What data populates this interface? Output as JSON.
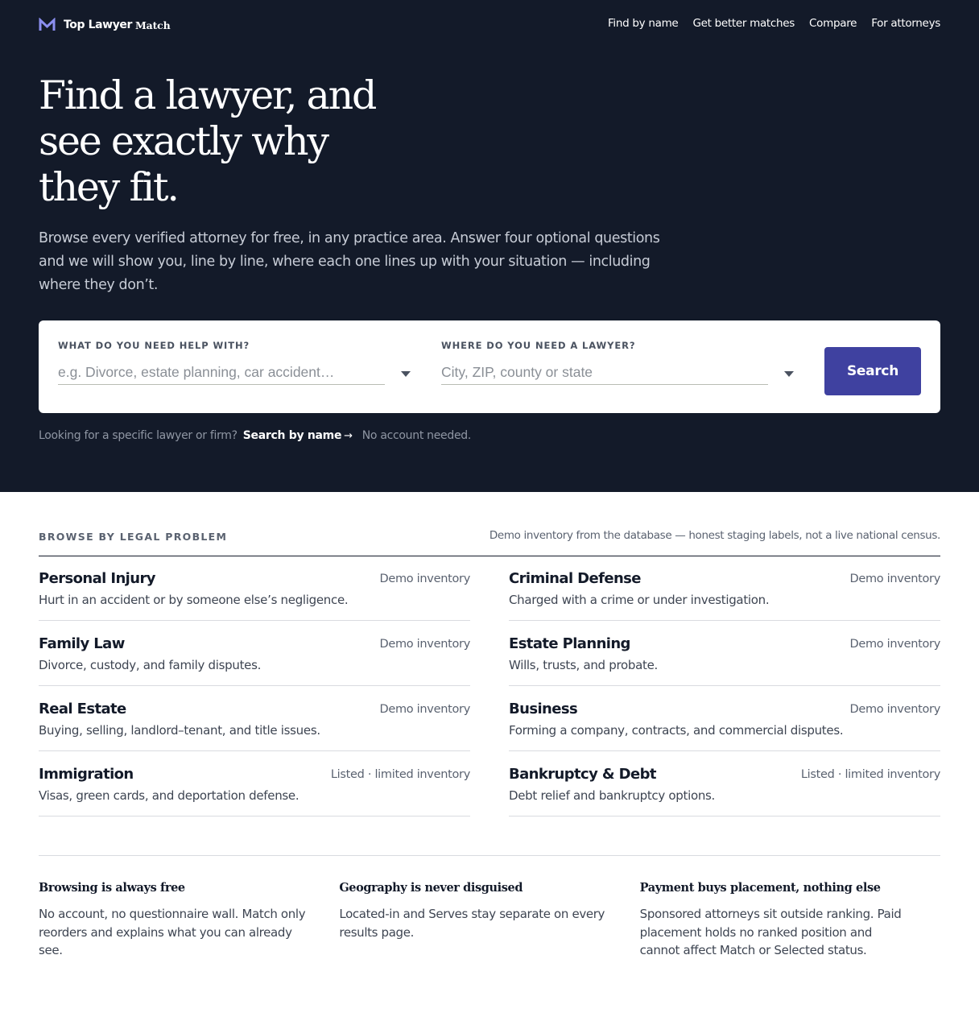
{
  "brand": {
    "main": "Top Lawyer",
    "sub": "Match",
    "icon": "m-logo-icon",
    "accent": "#8b8ff0"
  },
  "nav": {
    "items": [
      "Find by name",
      "Get better matches",
      "Compare",
      "For attorneys"
    ]
  },
  "hero": {
    "headline": "Find a lawyer, and see exactly why they fit.",
    "subtext": "Browse every verified attorney for free, in any practice area. Answer four optional questions and we will show you, line by line, where each one lines up with your situation — including where they don’t."
  },
  "search": {
    "problem_label": "WHAT DO YOU NEED HELP WITH?",
    "problem_placeholder": "e.g. Divorce, estate planning, car accident…",
    "location_label": "WHERE DO YOU NEED A LAWYER?",
    "location_placeholder": "City, ZIP, county or state",
    "button_label": "Search",
    "button_color": "#3f41a0"
  },
  "hint": {
    "text": "Looking for a specific lawyer or firm?",
    "link": "Search by name",
    "arrow": "→",
    "note": "No account needed."
  },
  "browse": {
    "title": "BROWSE BY LEGAL PROBLEM",
    "note": "Demo inventory from the database — honest staging labels, not a live national census.",
    "categories": [
      {
        "title": "Personal Injury",
        "status": "Demo inventory",
        "desc": "Hurt in an accident or by someone else’s negligence."
      },
      {
        "title": "Criminal Defense",
        "status": "Demo inventory",
        "desc": "Charged with a crime or under investigation."
      },
      {
        "title": "Family Law",
        "status": "Demo inventory",
        "desc": "Divorce, custody, and family disputes."
      },
      {
        "title": "Estate Planning",
        "status": "Demo inventory",
        "desc": "Wills, trusts, and probate."
      },
      {
        "title": "Real Estate",
        "status": "Demo inventory",
        "desc": "Buying, selling, landlord–tenant, and title issues."
      },
      {
        "title": "Business",
        "status": "Demo inventory",
        "desc": "Forming a company, contracts, and commercial disputes."
      },
      {
        "title": "Immigration",
        "status": "Listed · limited inventory",
        "desc": "Visas, green cards, and deportation defense."
      },
      {
        "title": "Bankruptcy & Debt",
        "status": "Listed · limited inventory",
        "desc": "Debt relief and bankruptcy options."
      }
    ]
  },
  "principles": [
    {
      "title": "Browsing is always free",
      "body": "No account, no questionnaire wall. Match only reorders and explains what you can already see."
    },
    {
      "title": "Geography is never disguised",
      "body": "Located-in and Serves stay separate on every results page."
    },
    {
      "title": "Payment buys placement, nothing else",
      "body": "Sponsored attorneys sit outside ranking. Paid placement holds no ranked position and cannot affect Match or Selected status."
    }
  ]
}
